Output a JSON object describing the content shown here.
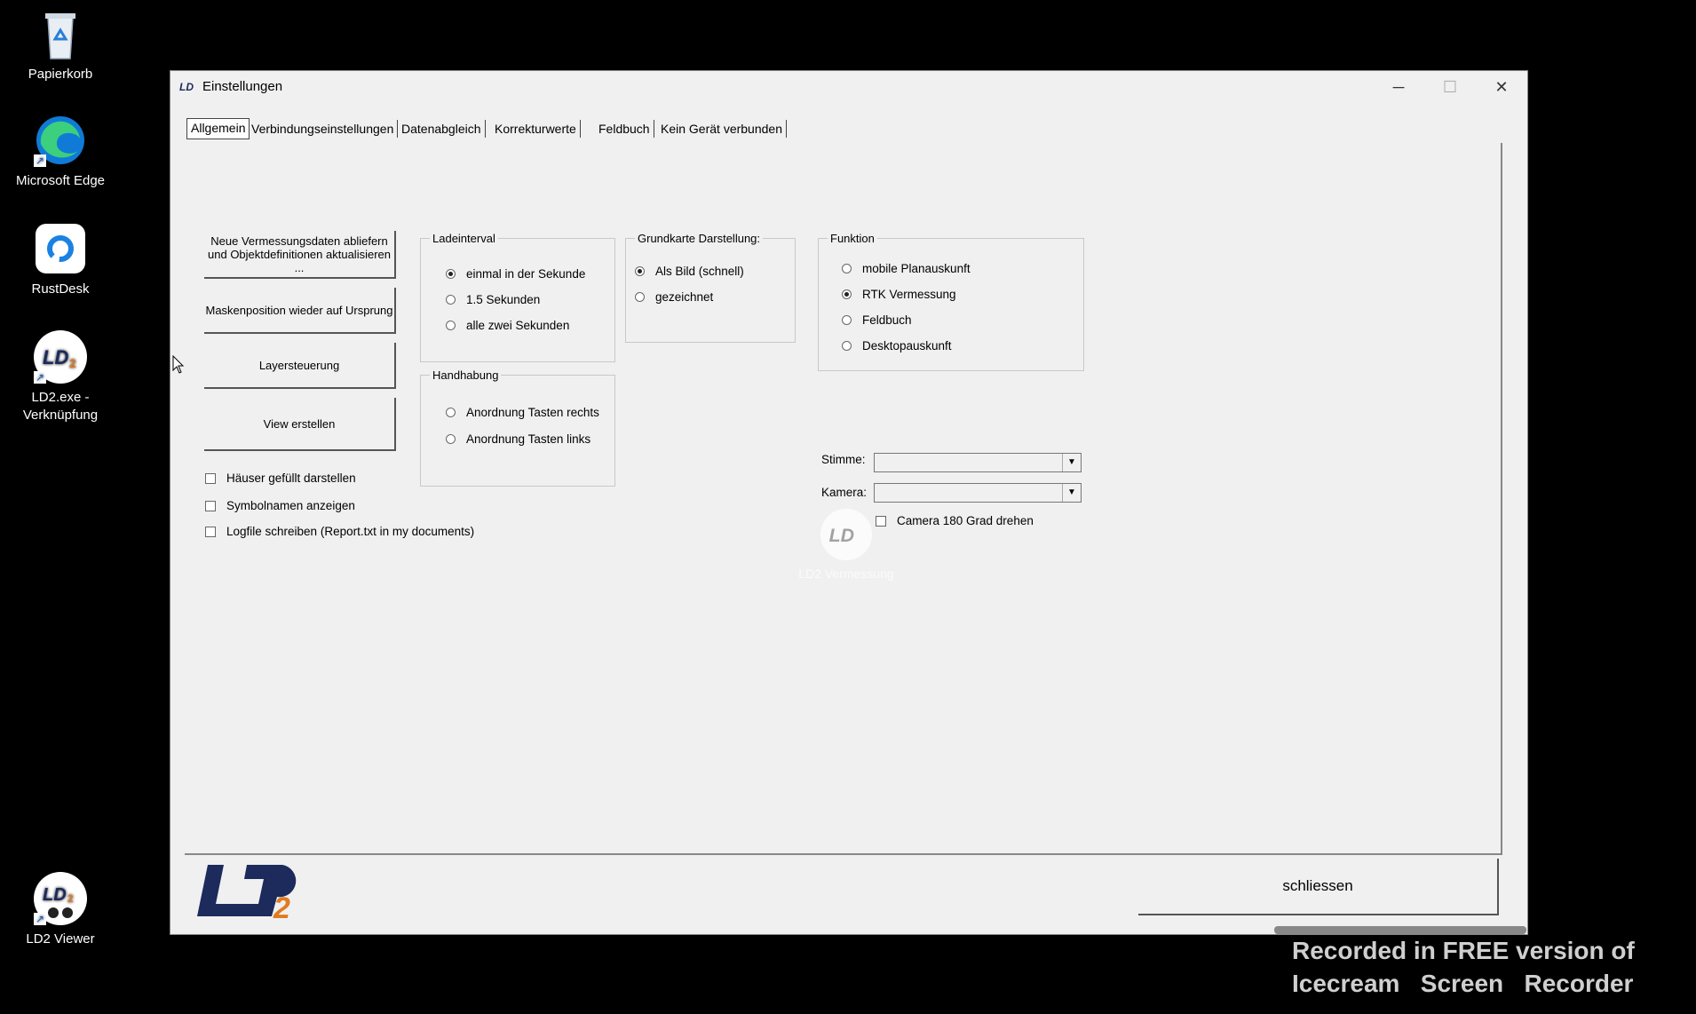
{
  "desktop": {
    "icons": [
      {
        "label": "Papierkorb",
        "icon": "recycle-bin-icon"
      },
      {
        "label": "Microsoft Edge",
        "icon": "edge-icon"
      },
      {
        "label": "RustDesk",
        "icon": "rustdesk-icon"
      },
      {
        "label": "LD2.exe - Verknüpfung",
        "icon": "ld2-icon"
      },
      {
        "label": "LD2 Viewer",
        "icon": "ld2-viewer-icon"
      }
    ],
    "floating_icon_label": "LD2 Vermessung"
  },
  "window": {
    "title": "Einstellungen",
    "controls": {
      "minimize": "─",
      "maximize": "☐",
      "close": "✕"
    }
  },
  "tabs": [
    "Allgemein",
    "Verbindungseinstellungen",
    "Datenabgleich",
    "Korrekturwerte",
    "Feldbuch",
    "Kein Gerät verbunden"
  ],
  "buttons": {
    "neue_daten": "Neue Vermessungsdaten abliefern und Objektdefinitionen aktualisieren ...",
    "maskenposition": "Maskenposition wieder auf Ursprung",
    "layersteuerung": "Layersteuerung",
    "view_erstellen": "View erstellen",
    "schliessen": "schliessen"
  },
  "checkboxes": {
    "haeuser": "Häuser gefüllt darstellen",
    "symbolnamen": "Symbolnamen anzeigen",
    "logfile": "Logfile schreiben (Report.txt in my documents)",
    "camera": "Camera 180 Grad drehen"
  },
  "ladeinterval": {
    "legend": "Ladeinterval",
    "options": [
      "einmal in der Sekunde",
      "1.5 Sekunden",
      "alle zwei Sekunden"
    ],
    "selected": "einmal in der Sekunde"
  },
  "handhabung": {
    "legend": "Handhabung",
    "options": [
      "Anordnung Tasten rechts",
      "Anordnung Tasten links"
    ],
    "selected": ""
  },
  "grundkarte": {
    "legend": "Grundkarte Darstellung:",
    "options": [
      "Als Bild (schnell)",
      "gezeichnet"
    ],
    "selected": "Als Bild (schnell)"
  },
  "funktion": {
    "legend": "Funktion",
    "options": [
      "mobile Planauskunft",
      "RTK Vermessung",
      "Feldbuch",
      "Desktopauskunft"
    ],
    "selected": "RTK Vermessung"
  },
  "fields": {
    "stimme_label": "Stimme:",
    "stimme_value": "",
    "kamera_label": "Kamera:",
    "kamera_value": ""
  },
  "watermark": {
    "line1": "Recorded in FREE version of",
    "line2": "Icecream   Screen   Recorder"
  },
  "colors": {
    "accent_blue": "#1c2a5c",
    "accent_orange": "#e07b20"
  }
}
